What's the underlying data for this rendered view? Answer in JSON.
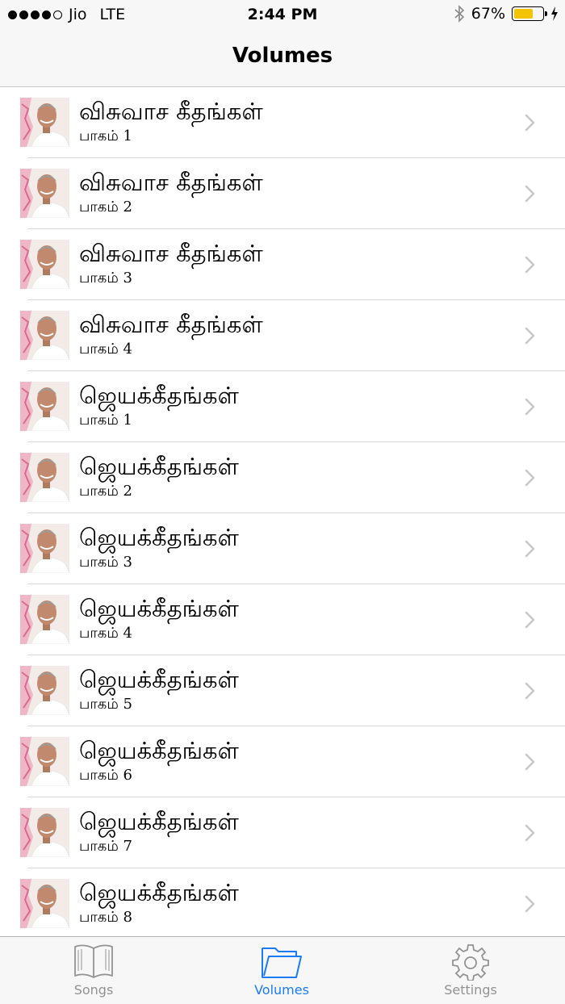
{
  "status_bar": {
    "carrier": "Jio",
    "network": "LTE",
    "time": "2:44 PM",
    "battery_percent": "67%",
    "battery_level": 0.67,
    "battery_color": "#f5c400"
  },
  "nav": {
    "title": "Volumes"
  },
  "volumes": [
    {
      "title": "விசுவாச கீதங்கள்",
      "subtitle": "பாகம் 1"
    },
    {
      "title": "விசுவாச கீதங்கள்",
      "subtitle": "பாகம் 2"
    },
    {
      "title": "விசுவாச கீதங்கள்",
      "subtitle": "பாகம் 3"
    },
    {
      "title": "விசுவாச கீதங்கள்",
      "subtitle": "பாகம் 4"
    },
    {
      "title": "ஜெயக்கீதங்கள்",
      "subtitle": "பாகம் 1"
    },
    {
      "title": "ஜெயக்கீதங்கள்",
      "subtitle": "பாகம் 2"
    },
    {
      "title": "ஜெயக்கீதங்கள்",
      "subtitle": "பாகம் 3"
    },
    {
      "title": "ஜெயக்கீதங்கள்",
      "subtitle": "பாகம் 4"
    },
    {
      "title": "ஜெயக்கீதங்கள்",
      "subtitle": "பாகம் 5"
    },
    {
      "title": "ஜெயக்கீதங்கள்",
      "subtitle": "பாகம் 6"
    },
    {
      "title": "ஜெயக்கீதங்கள்",
      "subtitle": "பாகம் 7"
    },
    {
      "title": "ஜெயக்கீதங்கள்",
      "subtitle": "பாகம் 8"
    }
  ],
  "tabbar": {
    "tabs": [
      {
        "label": "Songs",
        "icon": "book-icon",
        "active": false
      },
      {
        "label": "Volumes",
        "icon": "folder-icon",
        "active": true
      },
      {
        "label": "Settings",
        "icon": "gear-icon",
        "active": false
      }
    ],
    "active_color": "#1a7cf5",
    "inactive_color": "#929292"
  }
}
